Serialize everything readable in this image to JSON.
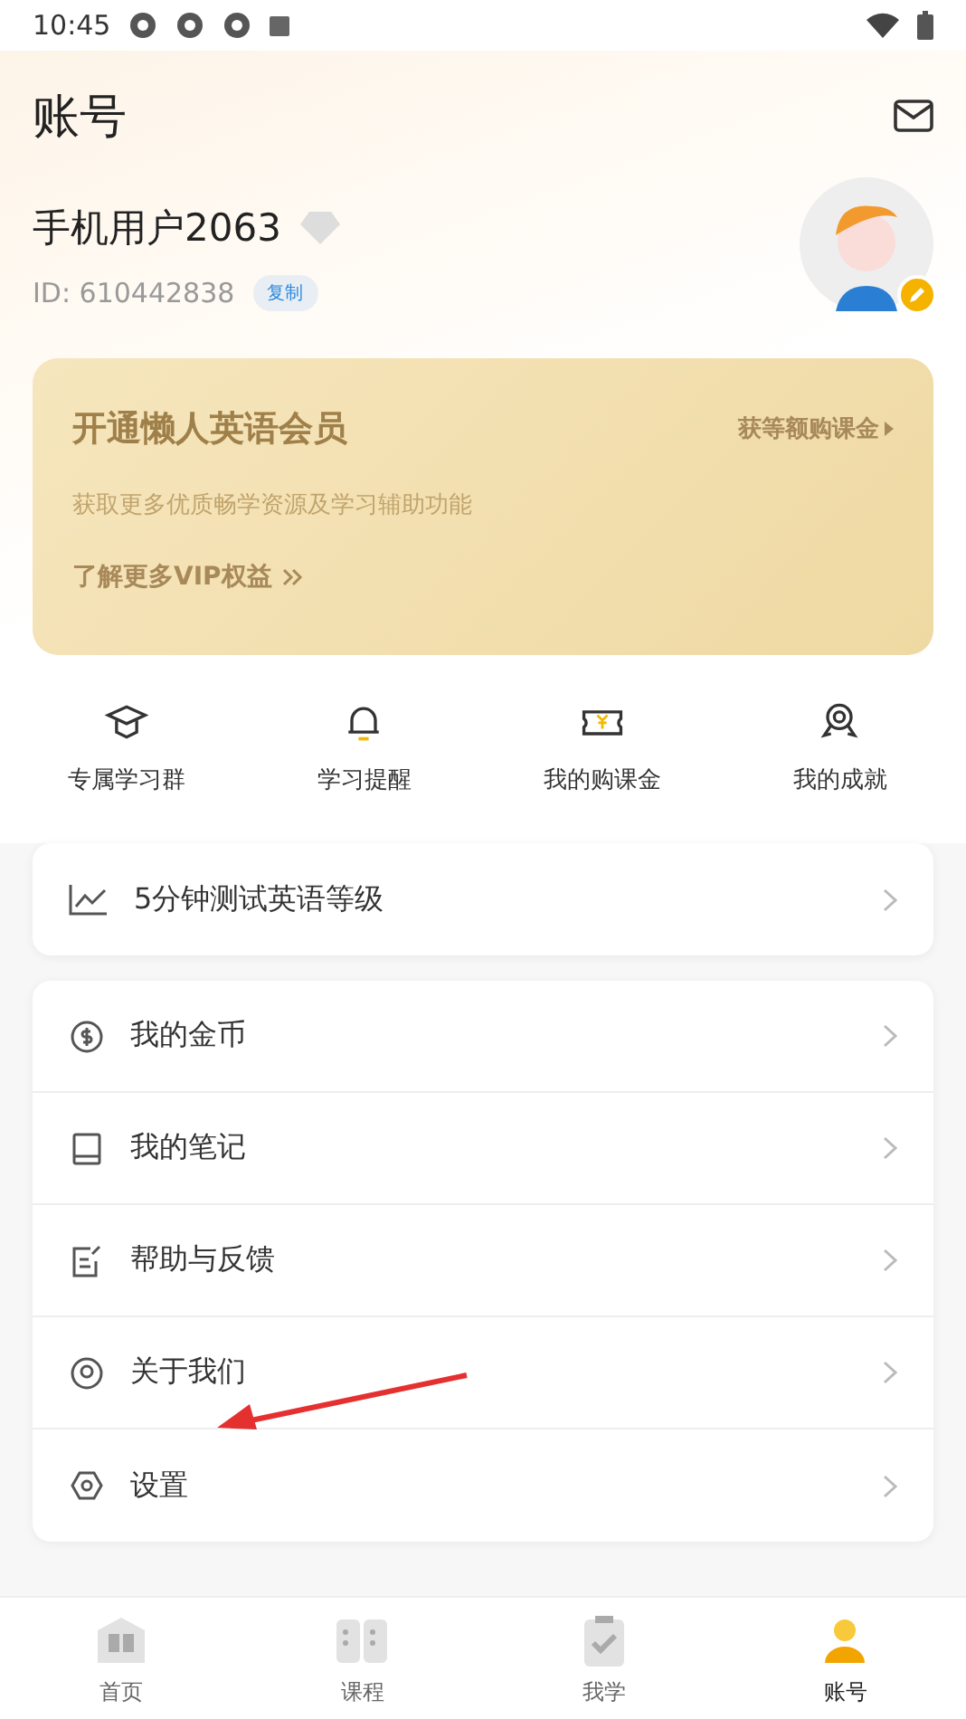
{
  "status_bar": {
    "time": "10:45"
  },
  "header": {
    "title": "账号"
  },
  "profile": {
    "name": "手机用户2063",
    "id": "ID: 610442838",
    "copy_label": "复制"
  },
  "vip_card": {
    "title": "开通懒人英语会员",
    "link": "获等额购课金",
    "subtitle": "获取更多优质畅学资源及学习辅助功能",
    "more": "了解更多VIP权益"
  },
  "shortcuts": [
    {
      "kind": "cap",
      "label": "专属学习群"
    },
    {
      "kind": "bell",
      "label": "学习提醒"
    },
    {
      "kind": "ticket",
      "label": "我的购课金"
    },
    {
      "kind": "medal",
      "label": "我的成就"
    }
  ],
  "test_row": {
    "label": "5分钟测试英语等级"
  },
  "menu": [
    {
      "kind": "coin",
      "label": "我的金币"
    },
    {
      "kind": "book",
      "label": "我的笔记"
    },
    {
      "kind": "feedback",
      "label": "帮助与反馈"
    },
    {
      "kind": "about",
      "label": "关于我们"
    },
    {
      "kind": "settings",
      "label": "设置"
    }
  ],
  "bottom_nav": [
    {
      "kind": "home",
      "label": "首页",
      "selected": false
    },
    {
      "kind": "courses",
      "label": "课程",
      "selected": false
    },
    {
      "kind": "study",
      "label": "我学",
      "selected": false
    },
    {
      "kind": "account",
      "label": "账号",
      "selected": true
    }
  ]
}
